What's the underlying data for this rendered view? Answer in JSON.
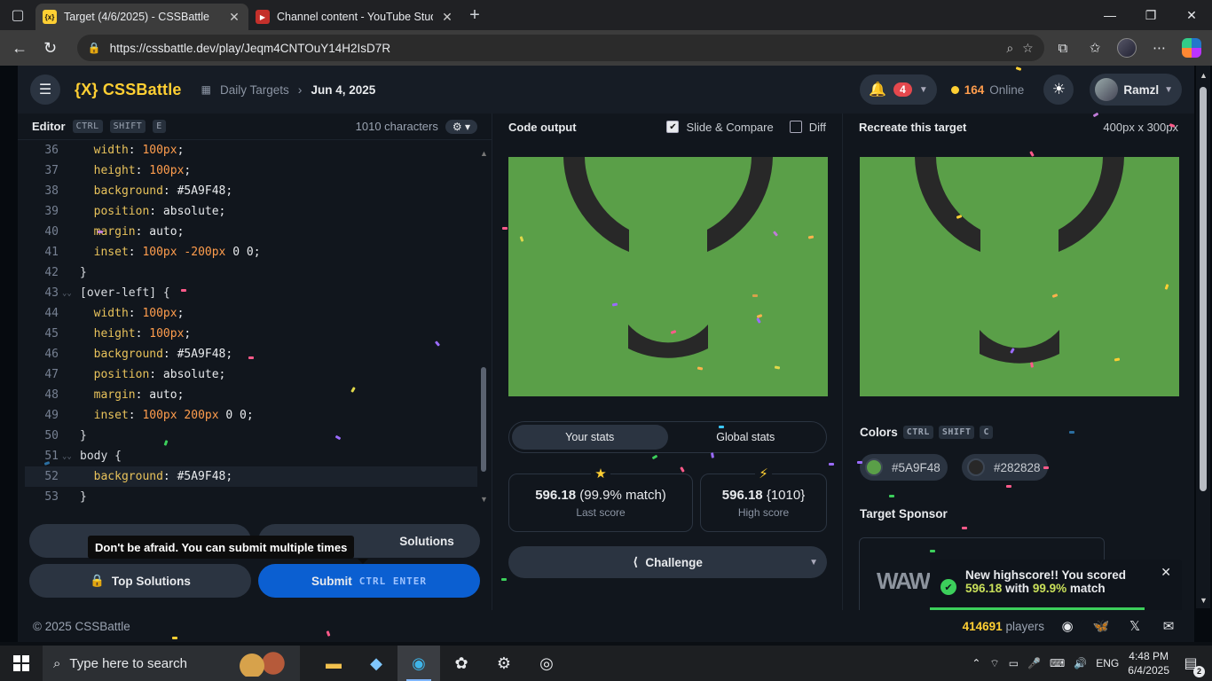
{
  "browser": {
    "tabs": [
      {
        "title": "Target (4/6/2025) - CSSBattle",
        "favicon": "{x}",
        "active": true
      },
      {
        "title": "Channel content - YouTube Studio",
        "favicon": "▶",
        "active": false
      }
    ],
    "url": "https://cssbattle.dev/play/Jeqm4CNTOuY14H2IsD7R"
  },
  "header": {
    "logo": "{X} CSSBattle",
    "breadcrumb_section": "Daily Targets",
    "breadcrumb_date": "Jun 4, 2025",
    "notification_count": "4",
    "online_count": "164",
    "online_label": "Online",
    "username": "Ramzl"
  },
  "editor": {
    "title": "Editor",
    "shortcut": [
      "CTRL",
      "SHIFT",
      "E"
    ],
    "char_count": "1010 characters",
    "lines": [
      {
        "n": "36",
        "parts": [
          [
            "p",
            "  width"
          ],
          [
            "v",
            ": "
          ],
          [
            "n",
            "100px"
          ],
          [
            "v",
            ";"
          ]
        ]
      },
      {
        "n": "37",
        "parts": [
          [
            "p",
            "  height"
          ],
          [
            "v",
            ": "
          ],
          [
            "n",
            "100px"
          ],
          [
            "v",
            ";"
          ]
        ]
      },
      {
        "n": "38",
        "parts": [
          [
            "p",
            "  background"
          ],
          [
            "v",
            ": #5A9F48;"
          ]
        ]
      },
      {
        "n": "39",
        "parts": [
          [
            "p",
            "  position"
          ],
          [
            "v",
            ": absolute;"
          ]
        ]
      },
      {
        "n": "40",
        "parts": [
          [
            "p",
            "  margin"
          ],
          [
            "v",
            ": auto;"
          ]
        ]
      },
      {
        "n": "41",
        "parts": [
          [
            "p",
            "  inset"
          ],
          [
            "v",
            ": "
          ],
          [
            "n",
            "100px"
          ],
          [
            "v",
            " "
          ],
          [
            "n",
            "-200px"
          ],
          [
            "v",
            " 0 0;"
          ]
        ]
      },
      {
        "n": "42",
        "parts": [
          [
            "s",
            "}"
          ]
        ]
      },
      {
        "n": "43",
        "parts": [
          [
            "s",
            "[over-left] {"
          ]
        ],
        "fold": true
      },
      {
        "n": "44",
        "parts": [
          [
            "p",
            "  width"
          ],
          [
            "v",
            ": "
          ],
          [
            "n",
            "100px"
          ],
          [
            "v",
            ";"
          ]
        ]
      },
      {
        "n": "45",
        "parts": [
          [
            "p",
            "  height"
          ],
          [
            "v",
            ": "
          ],
          [
            "n",
            "100px"
          ],
          [
            "v",
            ";"
          ]
        ]
      },
      {
        "n": "46",
        "parts": [
          [
            "p",
            "  background"
          ],
          [
            "v",
            ": #5A9F48;"
          ]
        ]
      },
      {
        "n": "47",
        "parts": [
          [
            "p",
            "  position"
          ],
          [
            "v",
            ": absolute;"
          ]
        ]
      },
      {
        "n": "48",
        "parts": [
          [
            "p",
            "  margin"
          ],
          [
            "v",
            ": auto;"
          ]
        ]
      },
      {
        "n": "49",
        "parts": [
          [
            "p",
            "  inset"
          ],
          [
            "v",
            ": "
          ],
          [
            "n",
            "100px"
          ],
          [
            "v",
            " "
          ],
          [
            "n",
            "200px"
          ],
          [
            "v",
            " 0 0;"
          ]
        ]
      },
      {
        "n": "50",
        "parts": [
          [
            "s",
            "}"
          ]
        ]
      },
      {
        "n": "51",
        "parts": [
          [
            "s",
            "body {"
          ]
        ],
        "fold": true
      },
      {
        "n": "52",
        "parts": [
          [
            "p",
            "  background"
          ],
          [
            "v",
            ": #5A9F48;"
          ]
        ],
        "highlight": true
      },
      {
        "n": "53",
        "parts": [
          [
            "s",
            "}"
          ]
        ]
      }
    ]
  },
  "actions": {
    "tooltip": "Don't be afraid. You can submit multiple times",
    "solutions_label": "Solutions",
    "top_solutions_label": "Top Solutions",
    "submit_label": "Submit",
    "submit_shortcut": "CTRL  ENTER"
  },
  "output": {
    "title": "Code output",
    "slide_compare_label": "Slide & Compare",
    "slide_compare_checked": true,
    "diff_label": "Diff",
    "diff_checked": false,
    "stats_tabs": [
      "Your stats",
      "Global stats"
    ],
    "last_score": "596.18",
    "last_match": "(99.9% match)",
    "last_label": "Last score",
    "high_score": "596.18",
    "high_chars": "{1010}",
    "high_label": "High score",
    "challenge_label": "Challenge"
  },
  "target": {
    "title": "Recreate this target",
    "size": "400px x 300px",
    "colors_label": "Colors",
    "colors_shortcut": [
      "CTRL",
      "SHIFT",
      "C"
    ],
    "colors": [
      {
        "hex": "#5A9F48",
        "swatch": "#5a9f48"
      },
      {
        "hex": "#282828",
        "swatch": "#282828"
      }
    ],
    "sponsor_label": "Target Sponsor",
    "sponsor_logo_text": "WAW"
  },
  "toast": {
    "line1": "New highscore!! You scored",
    "score": "596.18",
    "with": "with",
    "match": "99.9%",
    "match_suffix": "match"
  },
  "footer": {
    "copyright": "© 2025 CSSBattle",
    "players_count": "414691",
    "players_label": "players"
  },
  "taskbar": {
    "search_placeholder": "Type here to search",
    "language": "ENG",
    "time": "4:48 PM",
    "date": "6/4/2025",
    "notification_count": "2"
  },
  "palette": {
    "green": "#5A9F48",
    "dark": "#282828",
    "accent": "#ffcf33",
    "submit_blue": "#0b5fd1"
  }
}
